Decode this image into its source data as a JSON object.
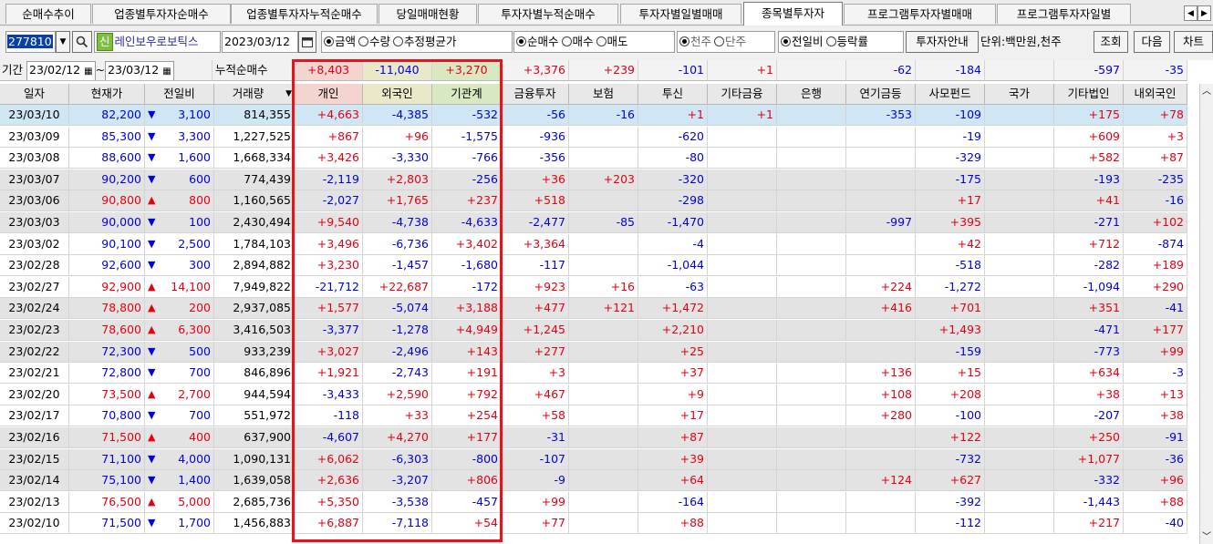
{
  "tabs": [
    "순매수추이",
    "업종별투자자순매수",
    "업종별투자자누적순매수",
    "당일매매현황",
    "투자자별누적순매수",
    "투자자별일별매매",
    "종목별투자자",
    "프로그램투자자별매매",
    "프로그램투자자일별"
  ],
  "active_tab": 6,
  "toolbar": {
    "code": "277810",
    "shin_badge": "신",
    "stock_name": "레인보우로보틱스",
    "date": "2023/03/12",
    "amount_opts": [
      "금액",
      "수량",
      "추정평균가"
    ],
    "trade_opts": [
      "순매수",
      "매수",
      "매도"
    ],
    "unit_opts": [
      "천주",
      "단주"
    ],
    "compare_opts": [
      "전일비",
      "등락률"
    ],
    "guide_button": "투자자안내",
    "unit_label": "단위:백만원,천주",
    "query_button": "조회",
    "next_button": "다음",
    "chart_button": "차트"
  },
  "summary": {
    "period_label": "기간",
    "date_from": "23/02/12",
    "tilde": "~",
    "date_to": "23/03/12",
    "cum_label": "누적순매수",
    "values": [
      "+8,403",
      "-11,040",
      "+3,270",
      "+3,376",
      "+239",
      "-101",
      "+1",
      "",
      "-62",
      "-184",
      "",
      "-597",
      "-35"
    ]
  },
  "headers": [
    "일자",
    "현재가",
    "전일비",
    "거래량",
    "개인",
    "외국인",
    "기관계",
    "금융투자",
    "보험",
    "투신",
    "기타금융",
    "은행",
    "연기금등",
    "사모펀드",
    "국가",
    "기타법인",
    "내외국인"
  ],
  "rows": [
    [
      "23/03/10",
      "82,200",
      "▼",
      "3,100",
      "814,355",
      "+4,663",
      "-4,385",
      "-532",
      "-56",
      "-16",
      "+1",
      "+1",
      "",
      "-353",
      "-109",
      "",
      "+175",
      "+78"
    ],
    [
      "23/03/09",
      "85,300",
      "▼",
      "3,300",
      "1,227,525",
      "+867",
      "+96",
      "-1,575",
      "-936",
      "",
      "-620",
      "",
      "",
      "",
      "-19",
      "",
      "+609",
      "+3"
    ],
    [
      "23/03/08",
      "88,600",
      "▼",
      "1,600",
      "1,668,334",
      "+3,426",
      "-3,330",
      "-766",
      "-356",
      "",
      "-80",
      "",
      "",
      "",
      "-329",
      "",
      "+582",
      "+87"
    ],
    [
      "23/03/07",
      "90,200",
      "▼",
      "600",
      "774,439",
      "-2,119",
      "+2,803",
      "-256",
      "+36",
      "+203",
      "-320",
      "",
      "",
      "",
      "-175",
      "",
      "-193",
      "-235"
    ],
    [
      "23/03/06",
      "90,800",
      "▲",
      "800",
      "1,160,565",
      "-2,027",
      "+1,765",
      "+237",
      "+518",
      "",
      "-298",
      "",
      "",
      "",
      "+17",
      "",
      "+41",
      "-16"
    ],
    [
      "23/03/03",
      "90,000",
      "▼",
      "100",
      "2,430,494",
      "+9,540",
      "-4,738",
      "-4,633",
      "-2,477",
      "-85",
      "-1,470",
      "",
      "",
      "-997",
      "+395",
      "",
      "-271",
      "+102"
    ],
    [
      "23/03/02",
      "90,100",
      "▼",
      "2,500",
      "1,784,103",
      "+3,496",
      "-6,736",
      "+3,402",
      "+3,364",
      "",
      "-4",
      "",
      "",
      "",
      "+42",
      "",
      "+712",
      "-874"
    ],
    [
      "23/02/28",
      "92,600",
      "▼",
      "300",
      "2,894,882",
      "+3,230",
      "-1,457",
      "-1,680",
      "-117",
      "",
      "-1,044",
      "",
      "",
      "",
      "-518",
      "",
      "-282",
      "+189"
    ],
    [
      "23/02/27",
      "92,900",
      "▲",
      "14,100",
      "7,949,822",
      "-21,712",
      "+22,687",
      "-172",
      "+923",
      "+16",
      "-63",
      "",
      "",
      "+224",
      "-1,272",
      "",
      "-1,094",
      "+290"
    ],
    [
      "23/02/24",
      "78,800",
      "▲",
      "200",
      "2,937,085",
      "+1,577",
      "-5,074",
      "+3,188",
      "+477",
      "+121",
      "+1,472",
      "",
      "",
      "+416",
      "+701",
      "",
      "+351",
      "-41"
    ],
    [
      "23/02/23",
      "78,600",
      "▲",
      "6,300",
      "3,416,503",
      "-3,377",
      "-1,278",
      "+4,949",
      "+1,245",
      "",
      "+2,210",
      "",
      "",
      "",
      "+1,493",
      "",
      "-471",
      "+177"
    ],
    [
      "23/02/22",
      "72,300",
      "▼",
      "500",
      "933,239",
      "+3,027",
      "-2,496",
      "+143",
      "+277",
      "",
      "+25",
      "",
      "",
      "",
      "-159",
      "",
      "-773",
      "+99"
    ],
    [
      "23/02/21",
      "72,800",
      "▼",
      "700",
      "846,896",
      "+1,921",
      "-2,743",
      "+191",
      "+3",
      "",
      "+37",
      "",
      "",
      "+136",
      "+15",
      "",
      "+634",
      "-3"
    ],
    [
      "23/02/20",
      "73,500",
      "▲",
      "2,700",
      "944,594",
      "-3,433",
      "+2,590",
      "+792",
      "+467",
      "",
      "+9",
      "",
      "",
      "+108",
      "+208",
      "",
      "+38",
      "+13"
    ],
    [
      "23/02/17",
      "70,800",
      "▼",
      "700",
      "551,972",
      "-118",
      "+33",
      "+254",
      "+58",
      "",
      "+17",
      "",
      "",
      "+280",
      "-100",
      "",
      "-207",
      "+38"
    ],
    [
      "23/02/16",
      "71,500",
      "▲",
      "400",
      "637,900",
      "-4,607",
      "+4,270",
      "+177",
      "-31",
      "",
      "+87",
      "",
      "",
      "",
      "+122",
      "",
      "+250",
      "-91"
    ],
    [
      "23/02/15",
      "71,100",
      "▼",
      "4,000",
      "1,090,131",
      "+6,062",
      "-6,303",
      "-800",
      "-107",
      "",
      "+39",
      "",
      "",
      "",
      "-732",
      "",
      "+1,077",
      "-36"
    ],
    [
      "23/02/14",
      "75,100",
      "▼",
      "1,400",
      "1,639,058",
      "+2,636",
      "-3,207",
      "+806",
      "-9",
      "",
      "+64",
      "",
      "",
      "+124",
      "+627",
      "",
      "-332",
      "+96"
    ],
    [
      "23/02/13",
      "76,500",
      "▲",
      "5,000",
      "2,685,736",
      "+5,350",
      "-3,538",
      "-457",
      "+99",
      "",
      "-164",
      "",
      "",
      "",
      "-392",
      "",
      "-1,443",
      "+88"
    ],
    [
      "23/02/10",
      "71,500",
      "▼",
      "1,700",
      "1,456,883",
      "+6,887",
      "-7,118",
      "+54",
      "+77",
      "",
      "+88",
      "",
      "",
      "",
      "-112",
      "",
      "+217",
      "-40"
    ]
  ],
  "row_styles": [
    "sel",
    "",
    "",
    "alt",
    "alt",
    "alt",
    "",
    "",
    "",
    "alt",
    "alt",
    "alt",
    "",
    "",
    "",
    "alt",
    "alt",
    "alt",
    "",
    ""
  ],
  "colors": {
    "up": "#e60012",
    "down": "#0000e0",
    "highlight_box": "#e8141c",
    "selected_row": "#cfe6f5"
  },
  "icons": {
    "calendar": "calendar-icon",
    "search": "search-icon",
    "dropdown": "chevron-down-icon"
  }
}
